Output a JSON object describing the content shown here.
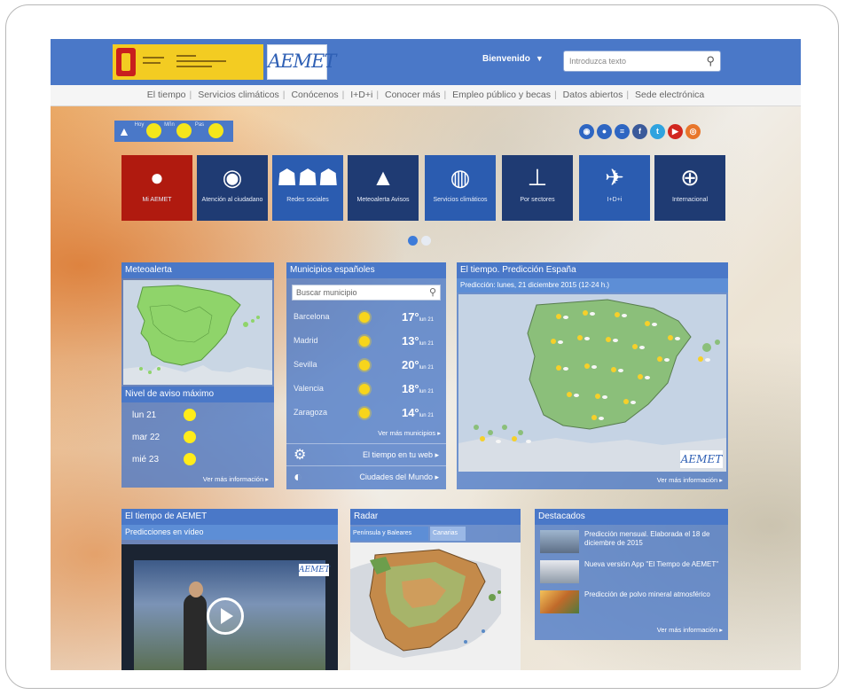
{
  "header": {
    "brand": "AEMET",
    "welcome_label": "Bienvenido",
    "search_placeholder": "Introduzca texto"
  },
  "nav": {
    "items": [
      "El tiempo",
      "Servicios climáticos",
      "Conócenos",
      "I+D+i",
      "Conocer más",
      "Empleo público y becas",
      "Datos abiertos",
      "Sede electrónica"
    ]
  },
  "warnings": {
    "days": [
      "Hoy",
      "Mñn",
      "Pas"
    ]
  },
  "social": {
    "icons": [
      "rss-icon",
      "chat-icon",
      "newsletter-icon",
      "facebook-icon",
      "twitter-icon",
      "youtube-icon",
      "podcast-icon"
    ]
  },
  "tiles": [
    {
      "label": "Mi AEMET",
      "icon": "user-icon"
    },
    {
      "label": "Atención al ciudadano",
      "icon": "support-icon"
    },
    {
      "label": "Redes sociales",
      "icon": "people-icon"
    },
    {
      "label": "Meteoalerta Avisos",
      "icon": "warning-icon"
    },
    {
      "label": "Servicios climáticos",
      "icon": "globe-icon"
    },
    {
      "label": "Por sectores",
      "icon": "org-chart-icon"
    },
    {
      "label": "I+D+i",
      "icon": "satellite-icon"
    },
    {
      "label": "Internacional",
      "icon": "world-search-icon"
    }
  ],
  "meteoalerta": {
    "title": "Meteoalerta",
    "subtitle": "Nivel de aviso máximo",
    "days": [
      "lun 21",
      "mar 22",
      "mié 23"
    ],
    "more_link": "Ver más información ▸"
  },
  "municipios": {
    "title": "Municipios españoles",
    "search_placeholder": "Buscar municipio",
    "cities": [
      {
        "name": "Barcelona",
        "temp": "17°",
        "unit": "lun 21"
      },
      {
        "name": "Madrid",
        "temp": "13°",
        "unit": "lun 21"
      },
      {
        "name": "Sevilla",
        "temp": "20°",
        "unit": "lun 21"
      },
      {
        "name": "Valencia",
        "temp": "18°",
        "unit": "lun 21"
      },
      {
        "name": "Zaragoza",
        "temp": "14°",
        "unit": "lun 21"
      }
    ],
    "more_link": "Ver más municipios ▸",
    "link1": "El tiempo en tu web ▸",
    "link2": "Ciudades del Mundo ▸"
  },
  "prediccion": {
    "title": "El tiempo. Predicción España",
    "subtitle": "Predicción: lunes, 21 diciembre 2015 (12-24 h.)",
    "more_link": "Ver más información ▸"
  },
  "video": {
    "title": "El tiempo de AEMET",
    "subtitle": "Predicciones en vídeo"
  },
  "radar": {
    "title": "Radar",
    "tab1": "Península y Baleares",
    "tab2": "Canarias"
  },
  "destacados": {
    "title": "Destacados",
    "items": [
      "Predicción mensual. Elaborada el 18 de diciembre de 2015",
      "Nueva versión App \"El Tiempo de AEMET\"",
      "Predicción de polvo mineral atmosférico"
    ],
    "more_link": "Ver más información ▸"
  }
}
